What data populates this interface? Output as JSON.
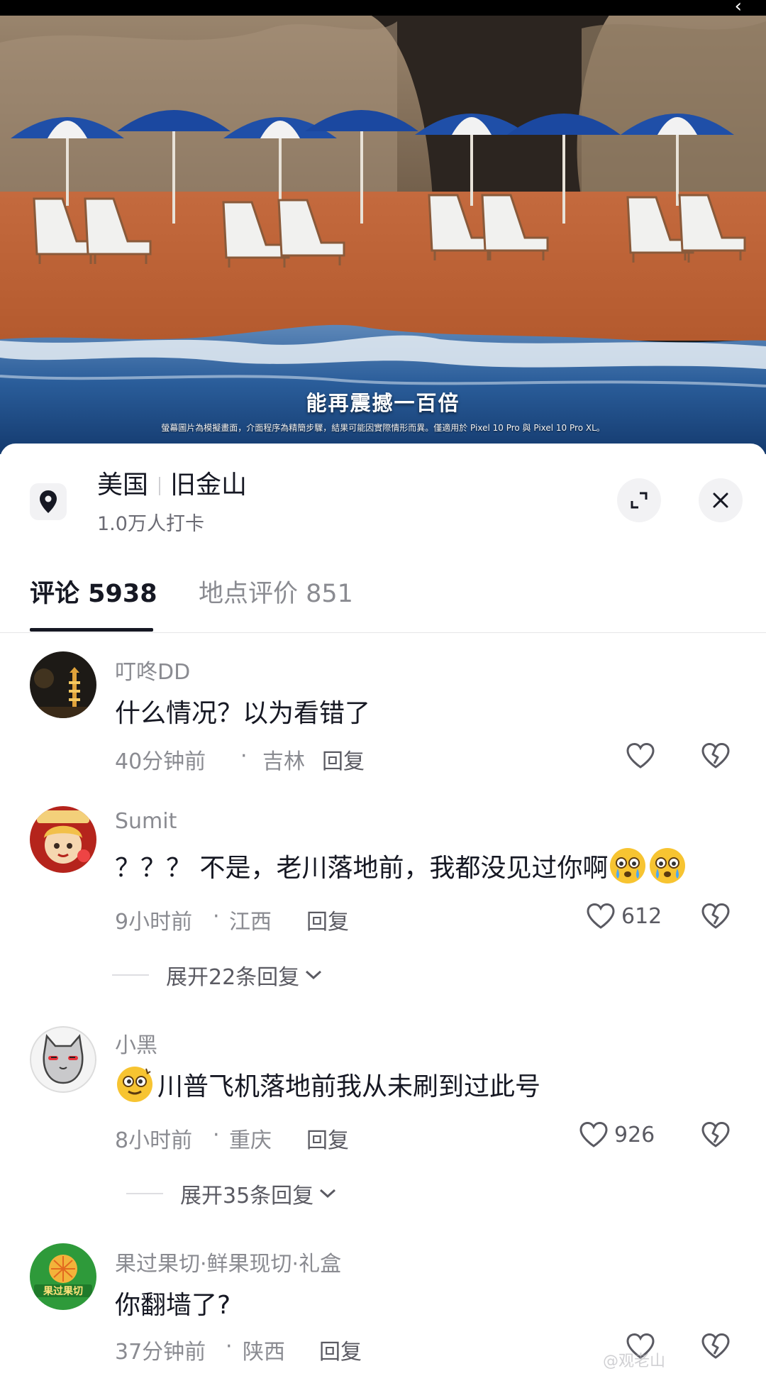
{
  "video": {
    "caption": "能再震撼一百倍",
    "disclaimer": "螢幕圖片為模擬畫面，介面程序為精簡步驟，結果可能因實際情形而異。僅適用於 Pixel 10 Pro 與 Pixel 10 Pro XL。"
  },
  "location": {
    "country": "美国",
    "city": "旧金山",
    "checkins": "1.0万人打卡",
    "pin_icon": "location-pin-icon",
    "expand_icon": "expand-icon",
    "close_icon": "close-icon"
  },
  "tabs": [
    {
      "label": "评论 5938",
      "active": true
    },
    {
      "label": "地点评价 851",
      "active": false
    }
  ],
  "comments": [
    {
      "user": "叮咚DD",
      "text": "什么情况？以为看错了",
      "time": "40分钟前",
      "region": "吉林",
      "reply": "回复",
      "likes": ""
    },
    {
      "user": "Sumit",
      "text": "？？？ 不是，老川落地前，我都没见过你啊",
      "time": "9小时前",
      "region": "江西",
      "reply": "回复",
      "likes": "612",
      "more_replies": "展开22条回复"
    },
    {
      "user": "小黑",
      "text": "川普飞机落地前我从未刷到过此号",
      "time": "8小时前",
      "region": "重庆",
      "reply": "回复",
      "likes": "926",
      "more_replies": "展开35条回复"
    },
    {
      "user": "果过果切·鲜果现切·礼盒",
      "text": "你翻墙了?",
      "time": "37分钟前",
      "region": "陕西",
      "reply": "回复",
      "likes": ""
    }
  ],
  "separator": "·",
  "watermark": "@观老山",
  "avatar_text": "果过果切",
  "colors": {
    "sand": "#c9663a",
    "sea": "#1d4f8c",
    "umbrella_blue": "#1f4fa8",
    "text_primary": "#161823",
    "text_secondary": "#8a8b91"
  }
}
